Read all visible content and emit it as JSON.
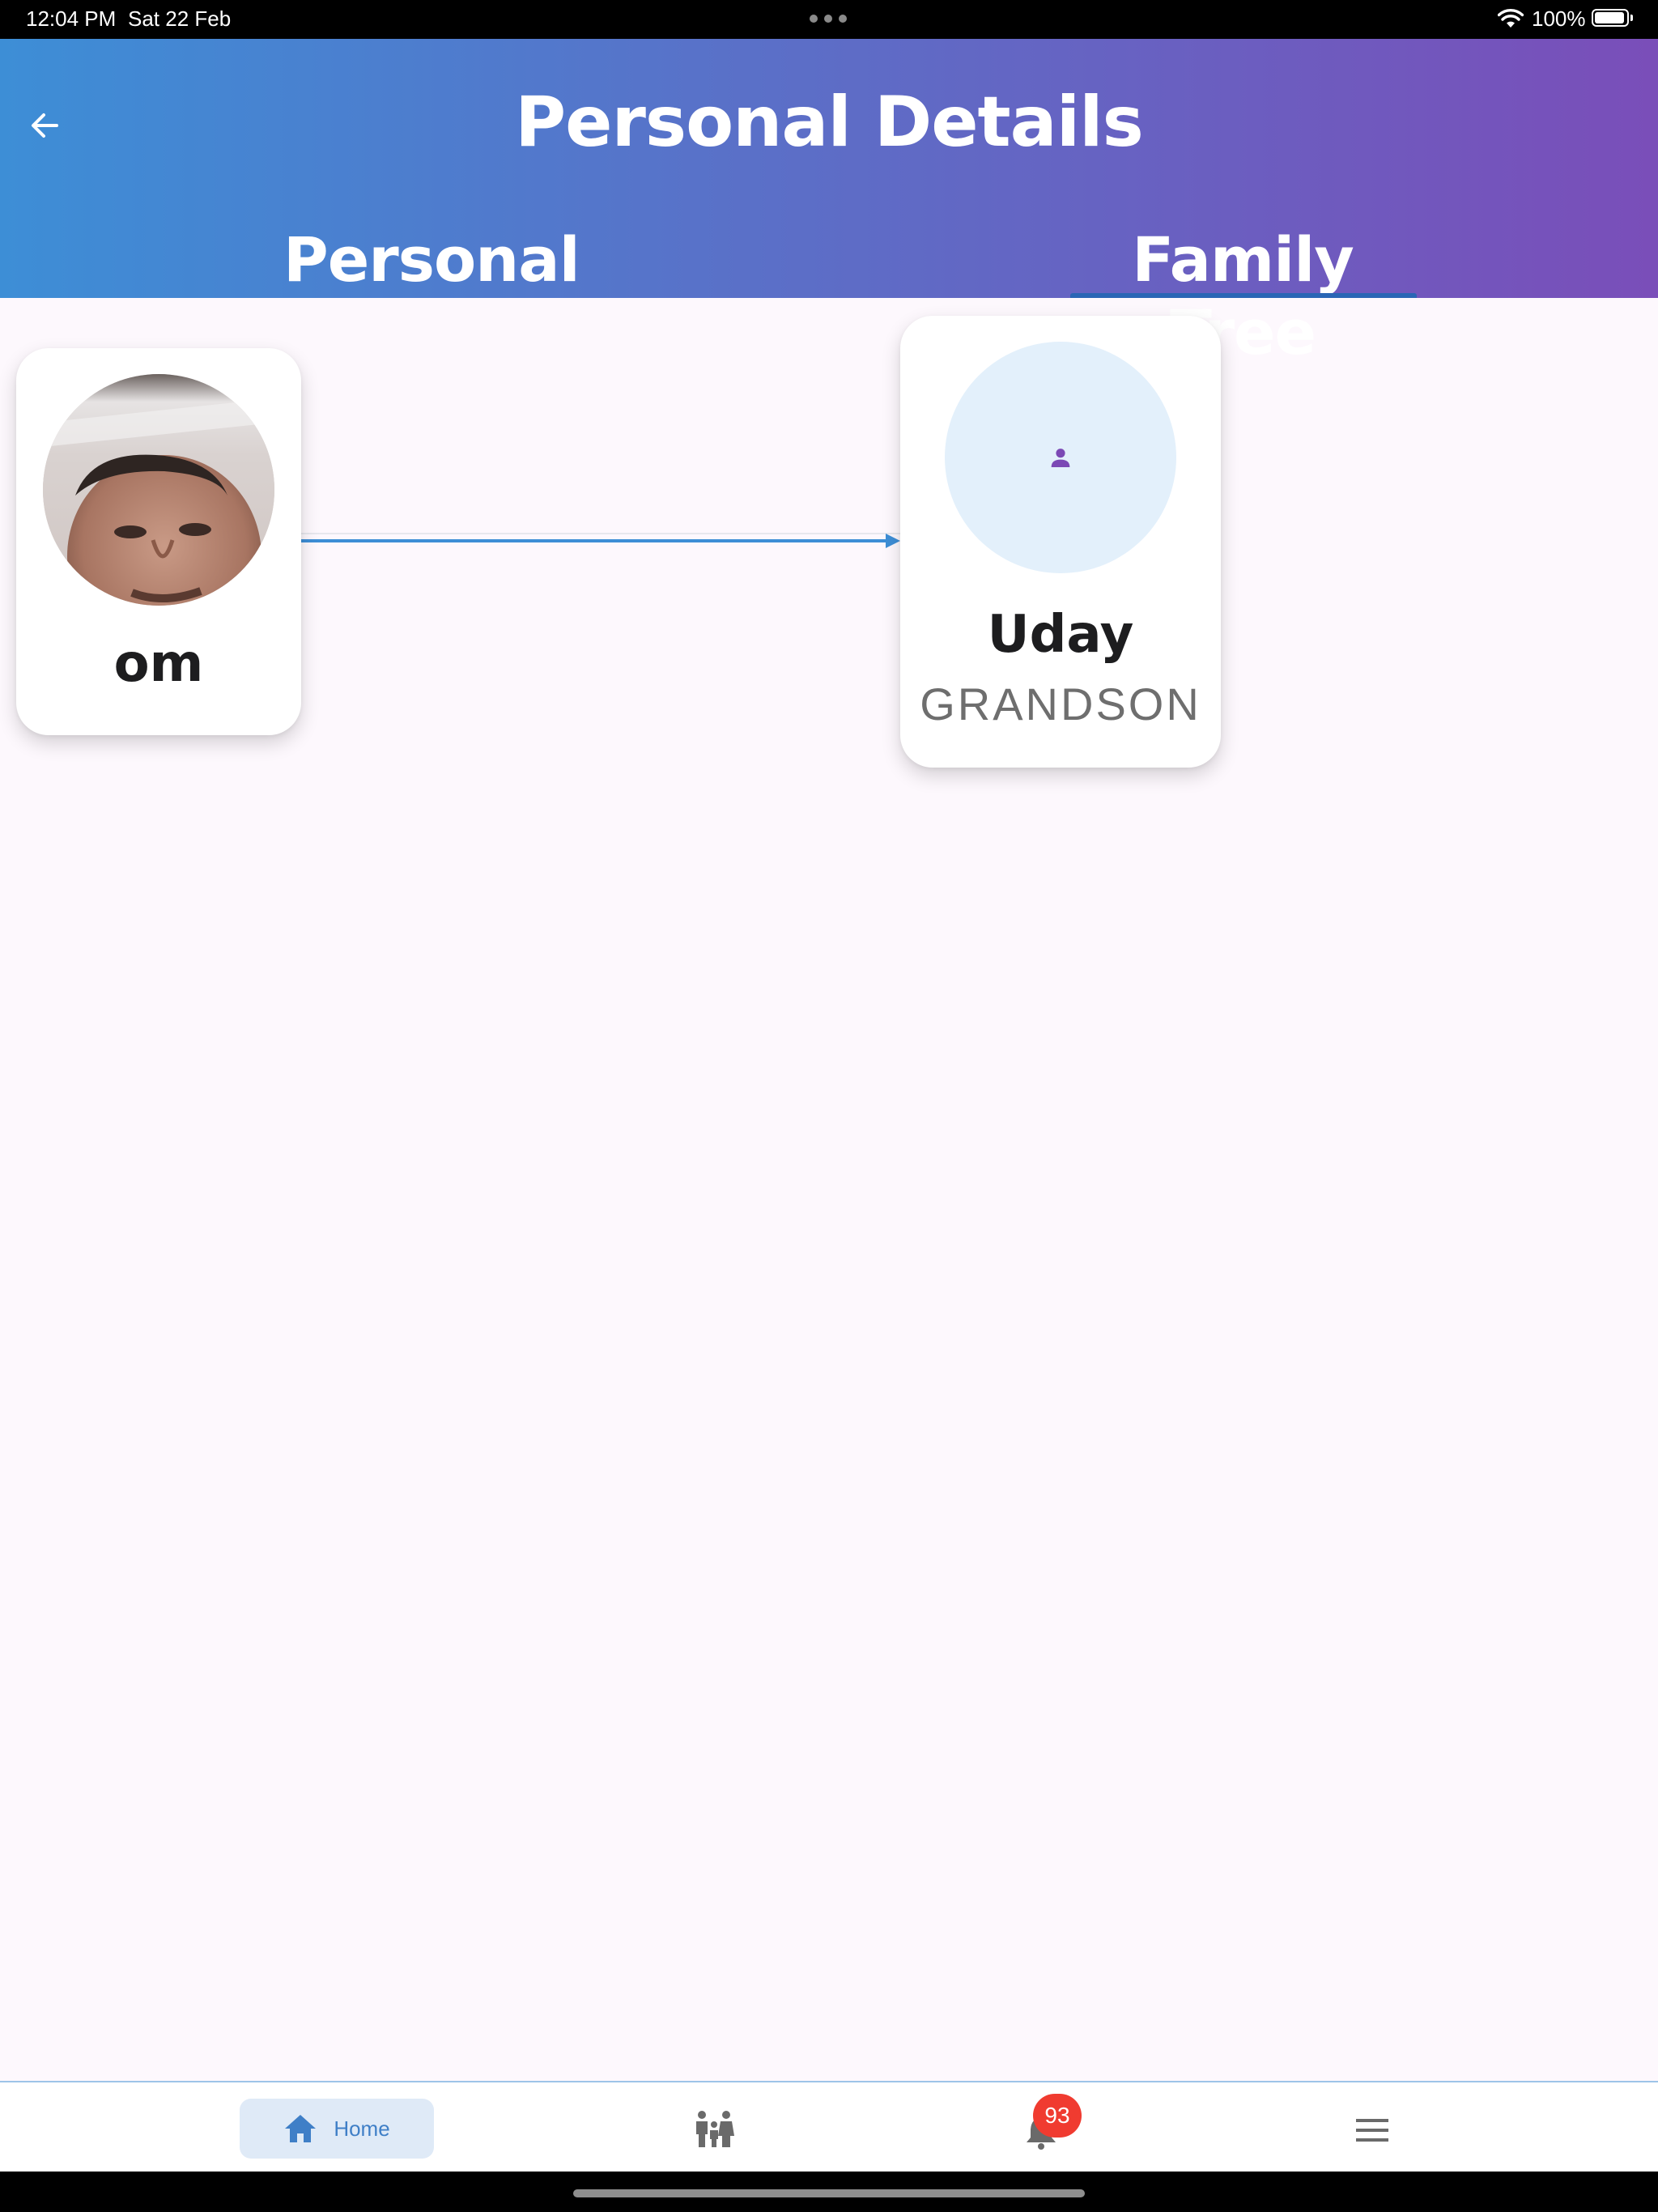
{
  "status_bar": {
    "time": "12:04 PM",
    "date": "Sat 22 Feb",
    "battery": "100%",
    "icons": [
      "wifi-icon",
      "battery-icon"
    ]
  },
  "header": {
    "title": "Personal Details",
    "back_icon": "arrow-left-icon",
    "tabs": [
      {
        "label": "Personal",
        "active": false
      },
      {
        "label": "Family Tree",
        "active": true
      }
    ]
  },
  "family_tree": {
    "nodes": [
      {
        "name": "om",
        "relation": "",
        "avatar": "photo"
      },
      {
        "name": "Uday",
        "relation": "GRANDSON",
        "avatar": "person-icon"
      }
    ],
    "connector_color": "#3d8ed6"
  },
  "bottom_nav": {
    "items": [
      {
        "label": "Home",
        "icon": "home-icon",
        "active": true
      },
      {
        "label": "",
        "icon": "family-icon",
        "active": false
      },
      {
        "label": "",
        "icon": "bell-icon",
        "badge": "93",
        "active": false
      },
      {
        "label": "",
        "icon": "menu-icon",
        "active": false
      }
    ]
  },
  "colors": {
    "header_gradient_start": "#3d8ed6",
    "header_gradient_end": "#7a4eb9",
    "accent": "#3f7fc7",
    "badge": "#f03b30",
    "placeholder_icon": "#7b49b5"
  }
}
